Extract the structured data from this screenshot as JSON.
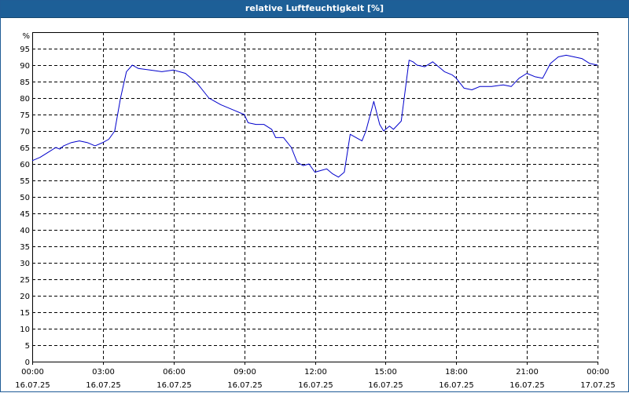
{
  "window": {
    "title": "relative Luftfeuchtigkeit [%]"
  },
  "colors": {
    "titlebar": "#1d5f97",
    "line": "#0000cc",
    "grid": "#000000"
  },
  "chart_data": {
    "type": "line",
    "title": "relative Luftfeuchtigkeit [%]",
    "ylabel": "%",
    "xlabel": "",
    "ylim": [
      0,
      100
    ],
    "yticks": [
      0,
      5,
      10,
      15,
      20,
      25,
      30,
      35,
      40,
      45,
      50,
      55,
      60,
      65,
      70,
      75,
      80,
      85,
      90,
      95
    ],
    "xlim": [
      "16.07.25 00:00",
      "17.07.25 00:00"
    ],
    "xticks": [
      {
        "time": "00:00",
        "date": "16.07.25"
      },
      {
        "time": "03:00",
        "date": "16.07.25"
      },
      {
        "time": "06:00",
        "date": "16.07.25"
      },
      {
        "time": "09:00",
        "date": "16.07.25"
      },
      {
        "time": "12:00",
        "date": "16.07.25"
      },
      {
        "time": "15:00",
        "date": "16.07.25"
      },
      {
        "time": "18:00",
        "date": "16.07.25"
      },
      {
        "time": "21:00",
        "date": "16.07.25"
      },
      {
        "time": "00:00",
        "date": "17.07.25"
      }
    ],
    "grid": true,
    "legend": "none",
    "series": [
      {
        "x": [
          "16.07.25 00:00",
          "16.07.25 00:20",
          "16.07.25 00:40",
          "16.07.25 01:00",
          "16.07.25 01:10",
          "16.07.25 01:20",
          "16.07.25 01:40",
          "16.07.25 02:00",
          "16.07.25 02:20",
          "16.07.25 02:40",
          "16.07.25 03:00",
          "16.07.25 03:15",
          "16.07.25 03:30",
          "16.07.25 03:45",
          "16.07.25 04:00",
          "16.07.25 04:15",
          "16.07.25 04:30",
          "16.07.25 05:00",
          "16.07.25 05:30",
          "16.07.25 06:00",
          "16.07.25 06:30",
          "16.07.25 07:00",
          "16.07.25 07:30",
          "16.07.25 08:00",
          "16.07.25 08:30",
          "16.07.25 09:00",
          "16.07.25 09:10",
          "16.07.25 09:30",
          "16.07.25 09:50",
          "16.07.25 10:10",
          "16.07.25 10:20",
          "16.07.25 10:40",
          "16.07.25 11:00",
          "16.07.25 11:15",
          "16.07.25 11:30",
          "16.07.25 11:45",
          "16.07.25 12:00",
          "16.07.25 12:15",
          "16.07.25 12:30",
          "16.07.25 12:45",
          "16.07.25 13:00",
          "16.07.25 13:15",
          "16.07.25 13:30",
          "16.07.25 13:45",
          "16.07.25 14:00",
          "16.07.25 14:10",
          "16.07.25 14:30",
          "16.07.25 14:45",
          "16.07.25 14:55",
          "16.07.25 15:10",
          "16.07.25 15:20",
          "16.07.25 15:40",
          "16.07.25 16:00",
          "16.07.25 16:10",
          "16.07.25 16:20",
          "16.07.25 16:40",
          "16.07.25 17:00",
          "16.07.25 17:30",
          "16.07.25 17:50",
          "16.07.25 18:00",
          "16.07.25 18:20",
          "16.07.25 18:40",
          "16.07.25 19:00",
          "16.07.25 19:30",
          "16.07.25 20:00",
          "16.07.25 20:20",
          "16.07.25 20:40",
          "16.07.25 21:00",
          "16.07.25 21:20",
          "16.07.25 21:40",
          "16.07.25 22:00",
          "16.07.25 22:20",
          "16.07.25 22:40",
          "16.07.25 23:00",
          "16.07.25 23:20",
          "16.07.25 23:40",
          "17.07.25 00:00"
        ],
        "values": [
          61,
          62,
          63.5,
          65,
          64.5,
          65.5,
          66.5,
          67,
          66.5,
          65.5,
          66.5,
          67.5,
          70,
          80,
          88,
          90,
          89,
          88.5,
          88,
          88.5,
          87.5,
          84.5,
          80,
          78,
          76.5,
          75,
          72.5,
          72,
          72,
          70.5,
          68,
          68,
          65,
          60.5,
          59.5,
          60,
          57.5,
          58,
          58.5,
          57,
          56,
          57.5,
          69,
          68,
          67,
          70,
          79,
          72,
          70,
          71.5,
          70.5,
          73,
          91.5,
          91,
          90,
          89.5,
          91,
          88,
          87,
          86,
          83,
          82.5,
          83.5,
          83.5,
          84,
          83.5,
          86,
          87.5,
          86.5,
          86,
          90.5,
          92.5,
          93,
          92.5,
          92,
          90.5,
          90
        ]
      }
    ]
  }
}
